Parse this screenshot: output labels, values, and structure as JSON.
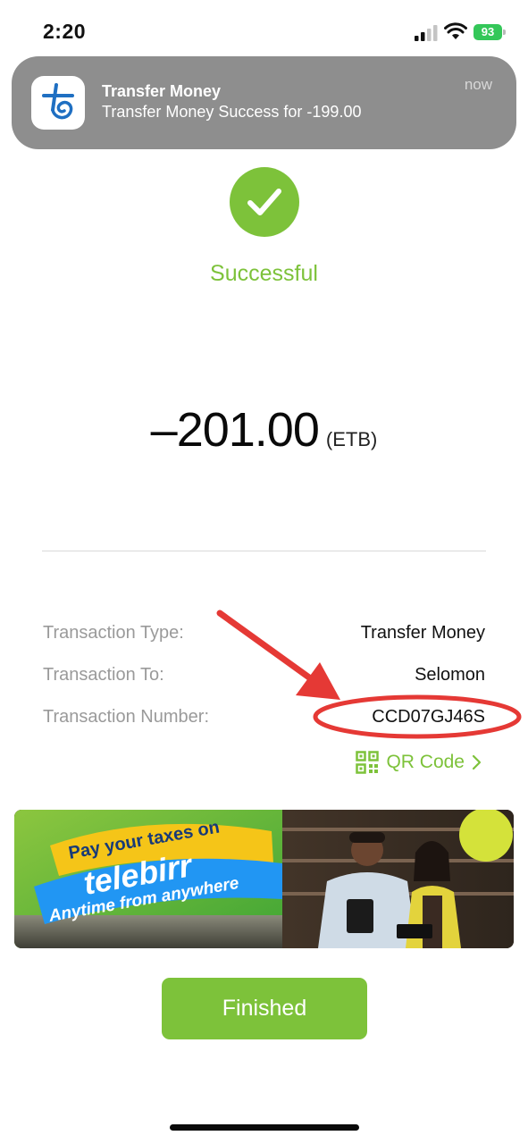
{
  "status_bar": {
    "time": "2:20",
    "battery": "93"
  },
  "notification": {
    "app_icon": "telebirr-app-icon",
    "title": "Transfer Money",
    "body": "Transfer Money Success for -199.00",
    "time": "now"
  },
  "result": {
    "icon": "check-icon",
    "status": "Successful",
    "amount": "–201.00",
    "currency": "(ETB)"
  },
  "details": [
    {
      "label": "Transaction Type:",
      "value": "Transfer Money"
    },
    {
      "label": "Transaction To:",
      "value": "Selomon"
    },
    {
      "label": "Transaction Number:",
      "value": "CCD07GJ46S"
    }
  ],
  "qr_link": {
    "label": "QR Code",
    "icon": "qr-code-icon"
  },
  "banner": {
    "line1": "Pay your taxes on",
    "brand": "telebirr",
    "line2": "Anytime from anywhere"
  },
  "finish_button": "Finished",
  "colors": {
    "accent_green": "#7dc23a",
    "annotation_red": "#e53935",
    "notification_gray": "#8e8e8e"
  }
}
